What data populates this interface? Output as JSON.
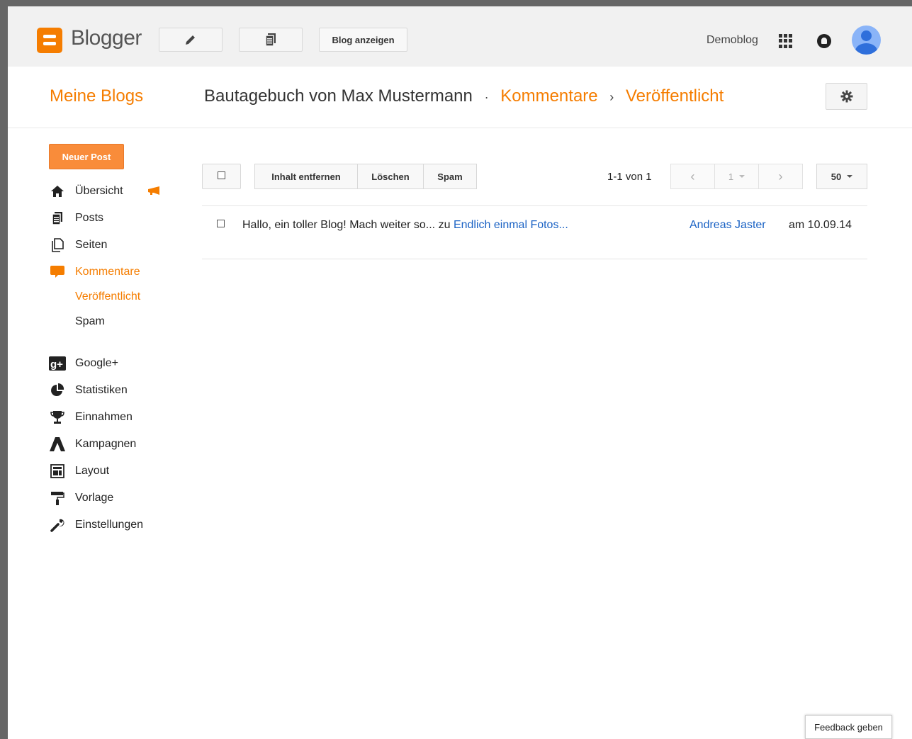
{
  "app": {
    "name": "Blogger",
    "view_blog_label": "Blog anzeigen",
    "blog_switcher_label": "Demoblog"
  },
  "header": {
    "my_blogs": "Meine Blogs",
    "blog_title": "Bautagebuch von Max Mustermann",
    "dot": "·",
    "section": "Kommentare",
    "arrow": "›",
    "subsection": "Veröffentlicht"
  },
  "sidebar": {
    "new_post": "Neuer Post",
    "items": [
      {
        "label": "Übersicht",
        "icon": "home-icon"
      },
      {
        "label": "Posts",
        "icon": "posts-icon"
      },
      {
        "label": "Seiten",
        "icon": "pages-icon"
      },
      {
        "label": "Kommentare",
        "icon": "comment-icon"
      },
      {
        "label": "Google+",
        "icon": "google-plus-icon"
      },
      {
        "label": "Statistiken",
        "icon": "pie-chart-icon"
      },
      {
        "label": "Einnahmen",
        "icon": "trophy-icon"
      },
      {
        "label": "Kampagnen",
        "icon": "adwords-icon"
      },
      {
        "label": "Layout",
        "icon": "layout-icon"
      },
      {
        "label": "Vorlage",
        "icon": "paint-roller-icon"
      },
      {
        "label": "Einstellungen",
        "icon": "wrench-icon"
      }
    ],
    "sub_items": [
      {
        "label": "Veröffentlicht"
      },
      {
        "label": "Spam"
      }
    ]
  },
  "toolbar": {
    "remove_content": "Inhalt entfernen",
    "delete": "Löschen",
    "spam": "Spam",
    "count": "1-1 von 1",
    "page": "1",
    "per_page": "50"
  },
  "comments": [
    {
      "text": "Hallo, ein toller Blog! Mach weiter so...",
      "to": "zu",
      "post": "Endlich einmal Fotos...",
      "author": "Andreas Jaster",
      "date": "am 10.09.14"
    }
  ],
  "feedback": "Feedback geben",
  "colors": {
    "accent": "#f57d00",
    "link": "#1a62c4",
    "topbar": "#f1f1f1"
  }
}
